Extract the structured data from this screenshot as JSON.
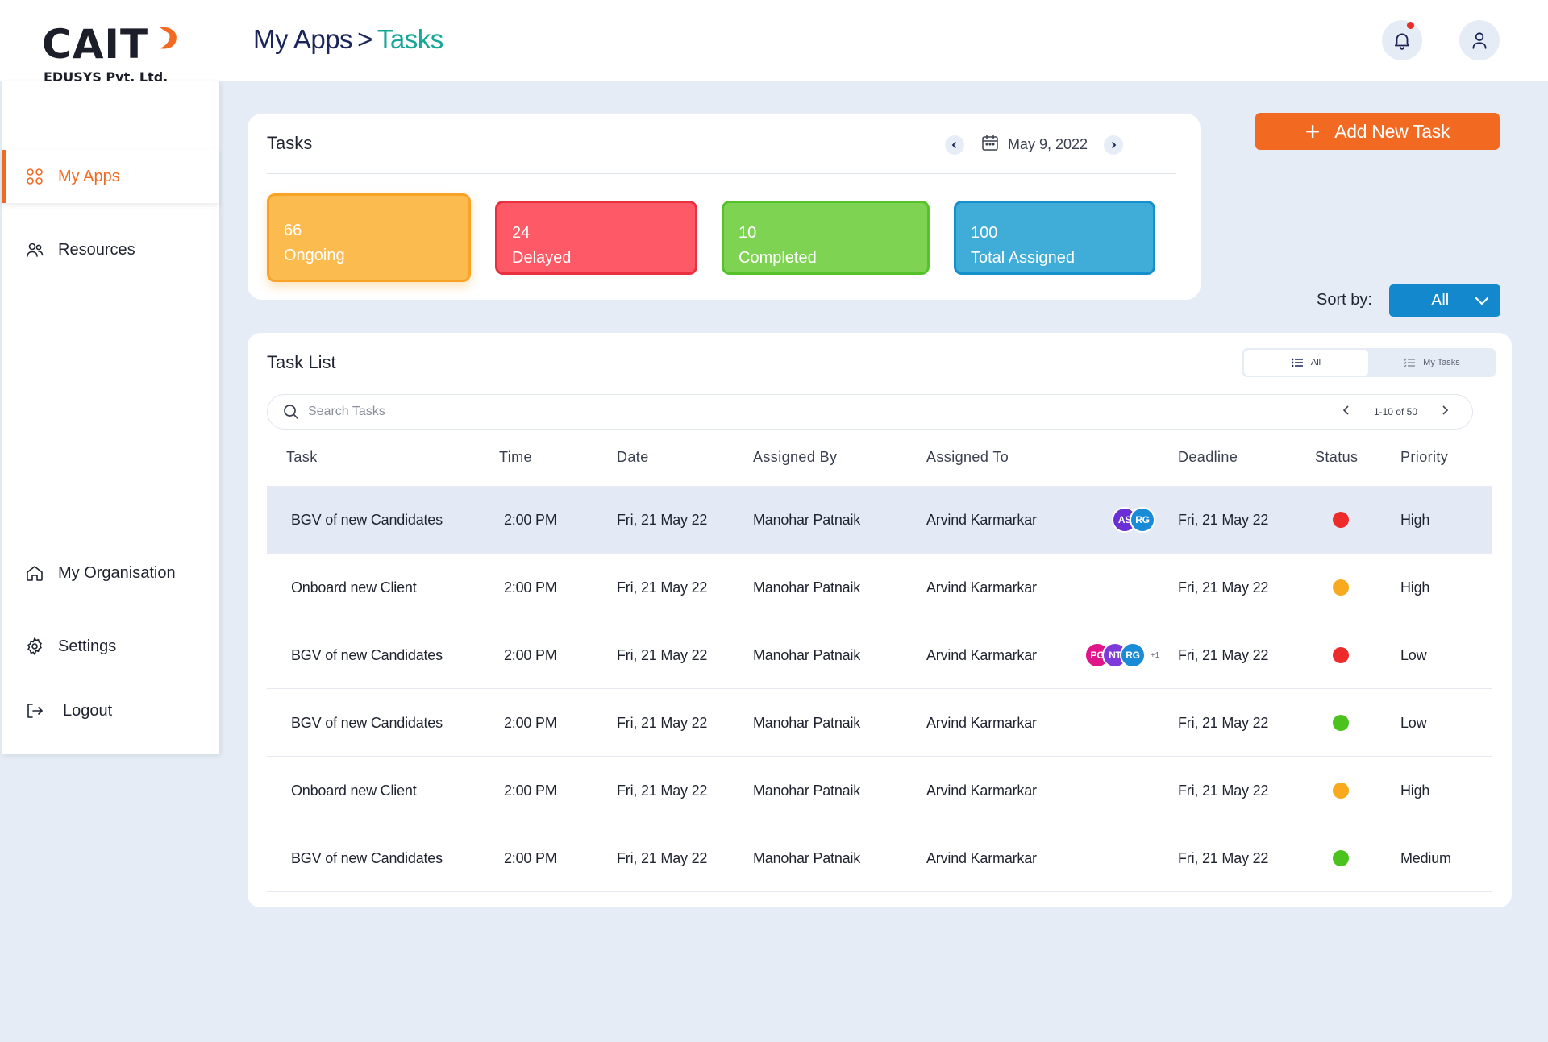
{
  "brand": {
    "name": "CAIT",
    "subtitle": "EDUSYS Pvt. Ltd."
  },
  "header": {
    "breadcrumb": [
      "My Apps",
      "Tasks"
    ],
    "separator": ">",
    "notification_dot_color": "#ee2b2b"
  },
  "sidebar": {
    "items": [
      {
        "label": "My Apps",
        "icon": "grid-icon",
        "active": true
      },
      {
        "label": "Resources",
        "icon": "users-icon",
        "active": false
      },
      {
        "label": "My Organisation",
        "icon": "home-icon",
        "active": false
      },
      {
        "label": "Settings",
        "icon": "gear-icon",
        "active": false
      },
      {
        "label": "Logout",
        "icon": "logout-icon",
        "active": false
      }
    ]
  },
  "summary": {
    "title": "Tasks",
    "date": "May 9, 2022",
    "stats": [
      {
        "value": "66",
        "label": "Ongoing",
        "color": "#fcbb4f"
      },
      {
        "value": "24",
        "label": "Delayed",
        "color": "#fd5966"
      },
      {
        "value": "10",
        "label": "Completed",
        "color": "#7fd353"
      },
      {
        "value": "100",
        "label": "Total Assigned",
        "color": "#40acd8"
      }
    ]
  },
  "actions": {
    "add_task_label": "Add New Task",
    "sort_label": "Sort by:",
    "sort_value": "All"
  },
  "task_list": {
    "title": "Task List",
    "view_toggle": {
      "all": "All",
      "mine": "My Tasks"
    },
    "search_placeholder": "Search Tasks",
    "pagination": "1-10 of 50",
    "columns": [
      "Task",
      "Time",
      "Date",
      "Assigned By",
      "Assigned To",
      "Deadline",
      "Status",
      "Priority"
    ],
    "rows": [
      {
        "task": "BGV of new Candidates",
        "time": "2:00 PM",
        "date": "Fri,  21 May 22",
        "assigned_by": "Manohar  Patnaik",
        "assigned_to": "Arvind Karmarkar",
        "avatars": [
          "AS",
          "RG"
        ],
        "more": "",
        "deadline": "Fri,  21 May 22",
        "status_color": "#ee2b2b",
        "priority": "High"
      },
      {
        "task": "Onboard new Client",
        "time": "2:00 PM",
        "date": "Fri,  21 May 22",
        "assigned_by": "Manohar  Patnaik",
        "assigned_to": "Arvind Karmarkar",
        "avatars": [],
        "more": "",
        "deadline": "Fri,  21 May 22",
        "status_color": "#f8a91e",
        "priority": "High"
      },
      {
        "task": "BGV of new Candidates",
        "time": "2:00 PM",
        "date": "Fri,  21 May 22",
        "assigned_by": "Manohar  Patnaik",
        "assigned_to": "Arvind Karmarkar",
        "avatars": [
          "PG",
          "NT",
          "RG"
        ],
        "more": "+1",
        "deadline": "Fri,  21 May 22",
        "status_color": "#ee2b2b",
        "priority": "Low"
      },
      {
        "task": "BGV of new Candidates",
        "time": "2:00 PM",
        "date": "Fri,  21 May 22",
        "assigned_by": "Manohar  Patnaik",
        "assigned_to": "Arvind Karmarkar",
        "avatars": [],
        "more": "",
        "deadline": "Fri,  21 May 22",
        "status_color": "#4cc21f",
        "priority": "Low"
      },
      {
        "task": "Onboard new Client",
        "time": "2:00 PM",
        "date": "Fri,  21 May 22",
        "assigned_by": "Manohar  Patnaik",
        "assigned_to": "Arvind Karmarkar",
        "avatars": [],
        "more": "",
        "deadline": "Fri,  21 May 22",
        "status_color": "#f8a91e",
        "priority": "High"
      },
      {
        "task": "BGV of new Candidates",
        "time": "2:00 PM",
        "date": "Fri,  21 May 22",
        "assigned_by": "Manohar  Patnaik",
        "assigned_to": "Arvind Karmarkar",
        "avatars": [],
        "more": "",
        "deadline": "Fri,  21 May 22",
        "status_color": "#4cc21f",
        "priority": "Medium"
      }
    ],
    "avatar_colors": {
      "AS": "#6b2fd6",
      "RG": "#1a8bd6",
      "PG": "#e0158a",
      "NT": "#7d3ad8"
    }
  },
  "colors": {
    "accent": "#f26a21",
    "teal": "#16a797",
    "navy": "#1b2558",
    "sort_blue": "#1488cd"
  }
}
